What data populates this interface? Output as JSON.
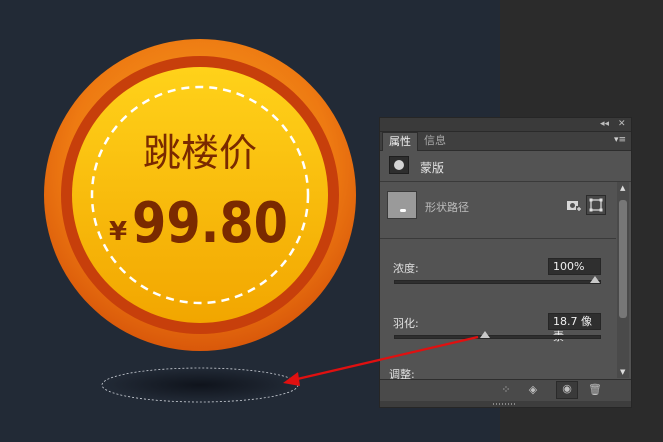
{
  "badge": {
    "title": "跳楼价",
    "currency": "¥",
    "price": "99.80"
  },
  "panel": {
    "tab_active": "属性",
    "tab_inactive": "信息",
    "collapse_glyph": "◂◂",
    "close_glyph": "✕",
    "menu_glyph": "▾≡",
    "mask_label": "蒙版",
    "path_label": "形状路径",
    "density_label": "浓度:",
    "density_value": "100%",
    "density_level": 1.0,
    "feather_label": "羽化:",
    "feather_value": "18.7 像素",
    "feather_level": 0.44,
    "adjust_label": "调整:"
  },
  "colors": {
    "canvas_bg": "#222a36",
    "badge_outer": "#e2650b",
    "badge_ring": "#c0400c",
    "badge_inner": "#f7b500",
    "badge_text": "#7a2a00",
    "arrow": "#e01010"
  }
}
